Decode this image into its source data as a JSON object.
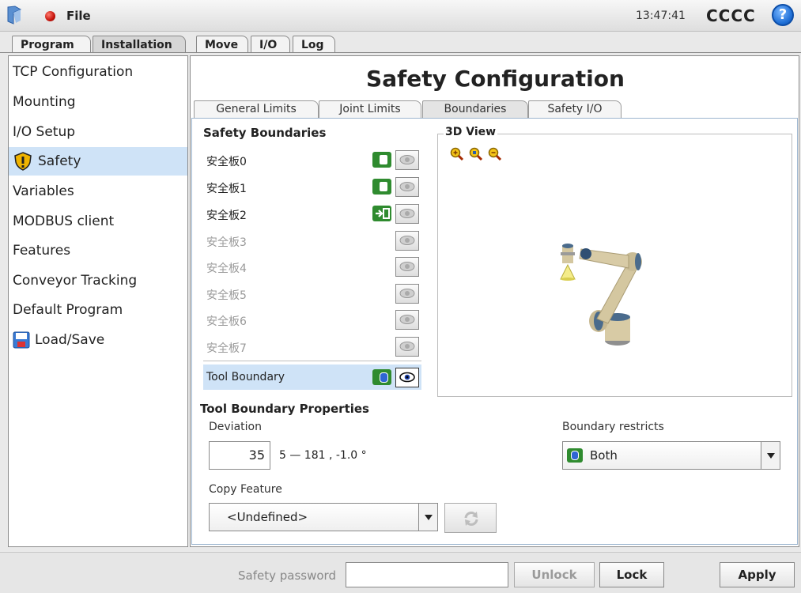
{
  "topbar": {
    "file_menu": "File",
    "clock": "13:47:41",
    "robot_name": "CCCC",
    "help": "?"
  },
  "tabs": [
    {
      "label": "Program"
    },
    {
      "label": "Installation"
    },
    {
      "label": "Move"
    },
    {
      "label": "I/O"
    },
    {
      "label": "Log"
    }
  ],
  "sidebar": {
    "items": [
      {
        "label": "TCP Configuration"
      },
      {
        "label": "Mounting"
      },
      {
        "label": "I/O Setup"
      },
      {
        "label": "Safety"
      },
      {
        "label": "Variables"
      },
      {
        "label": "MODBUS client"
      },
      {
        "label": "Features"
      },
      {
        "label": "Conveyor Tracking"
      },
      {
        "label": "Default Program"
      },
      {
        "label": "Load/Save"
      }
    ]
  },
  "main": {
    "title": "Safety Configuration",
    "subtabs": [
      {
        "label": "General Limits"
      },
      {
        "label": "Joint Limits"
      },
      {
        "label": "Boundaries"
      },
      {
        "label": "Safety I/O"
      }
    ],
    "boundaries_title": "Safety Boundaries",
    "planes": [
      {
        "label": "安全板0"
      },
      {
        "label": "安全板1"
      },
      {
        "label": "安全板2"
      },
      {
        "label": "安全板3"
      },
      {
        "label": "安全板4"
      },
      {
        "label": "安全板5"
      },
      {
        "label": "安全板6"
      },
      {
        "label": "安全板7"
      }
    ],
    "tool_boundary": "Tool Boundary",
    "view_title": "3D View",
    "props_title": "Tool Boundary Properties",
    "deviation_label": "Deviation",
    "deviation_value": "35",
    "deviation_range": "5 — 181 , -1.0 °",
    "boundary_restricts_label": "Boundary restricts",
    "boundary_restricts_value": "Both",
    "copy_feature_label": "Copy Feature",
    "copy_feature_value": "<Undefined>"
  },
  "bottombar": {
    "password_label": "Safety password",
    "unlock": "Unlock",
    "lock": "Lock",
    "apply": "Apply"
  },
  "colors": {
    "accent_selected": "#cfe3f7",
    "toggle_green": "#2f8b2f",
    "status_red": "#c4120a",
    "help_blue": "#1f6fd6"
  }
}
